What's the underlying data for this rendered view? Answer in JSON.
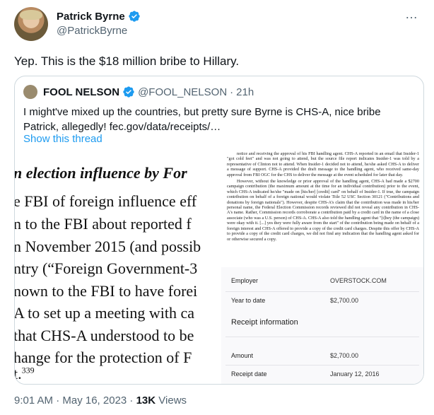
{
  "author": {
    "name": "Patrick Byrne",
    "handle": "@PatrickByrne"
  },
  "more_icon": "…",
  "tweet_text": "Yep. This is the $18 million bribe to Hillary.",
  "quote": {
    "name": "FOOL NELSON",
    "handle": "@FOOL_NELSON",
    "dot": "·",
    "time": "21h",
    "text": "I might've mixed up the countries, but pretty sure Byrne is CHS-A, nice bribe Patrick, allegedly! fec.gov/data/receipts/…",
    "show_thread": "Show this thread"
  },
  "document_left": {
    "heading": "n election influence by For",
    "lines": [
      "e FBI of foreign influence eff",
      "n to the FBI about reported f",
      "n November 2015 (and possib",
      "ntry (“Foreign Government-3",
      "nown to the FBI to have forei",
      "A to set up a meeting with ca",
      "that CHS-A understood to be",
      "hange for the protection of F"
    ],
    "footnote": "t.",
    "footnote_number": "339"
  },
  "document_right": {
    "para1": "notice and receiving the approval of his FBI handling agent. CHS-A reported in an email that Insider-1 \"got cold feet\" and was not going to attend, but the source file report indicates Insider-1 was told by a representative of Clinton not to attend. When Insider-1 decided not to attend, he/she asked CHS-A to deliver a message of support. CHS-A provided the draft message to the handling agent, who received same-day approval from FBI OGC for the CHS to deliver the message at the event scheduled for later that day.",
    "para2": "However, without the knowledge or prior approval of the handling agent, CHS-A had made a $2700 campaign contribution (the maximum amount at the time for an individual contribution) prior to the event, which CHS-A indicated he/she \"made on [his/her] [credit] card\" on behalf of Insider-1. If true, the campaign contribution on behalf of a foreign national would violate Title 52 USC Section 30121 (\"Contributions and donations by foreign nationals\"). However, despite CHS-A's claim that the contribution was made in his/her personal name, the Federal Election Commission records reviewed did not reveal any contribution in CHS-A's name. Rather, Commission records corroborate a contribution paid by a credit card in the name of a close associate (who was a U.S. person) of CHS-A. CHS-A also told the handling agent that \"[t]hey (the campaign) were okay with it. [...] yes they were fully aware from the start\" of the contribution being made on behalf of a foreign interest and CHS-A offered to provide a copy of the credit card charges. Despite this offer by CHS-A to provide a copy of the credit card charges, we did not find any indication that the handling agent asked for or otherwise secured a copy."
  },
  "receipt": {
    "employer_label": "Employer",
    "employer_value": "OVERSTOCK.COM",
    "ytd_label": "Year to date",
    "ytd_value": "$2,700.00",
    "section_title": "Receipt information",
    "amount_label": "Amount",
    "amount_value": "$2,700.00",
    "date_label": "Receipt date",
    "date_value": "January 12, 2016"
  },
  "meta": {
    "timestamp": "9:01 AM · May 16, 2023 · ",
    "views_count": "13K",
    "views_label": " Views"
  },
  "colors": {
    "verified": "#1d9bf0",
    "link": "#1d9bf0",
    "secondary_text": "#536471",
    "border": "#cfd9de"
  }
}
